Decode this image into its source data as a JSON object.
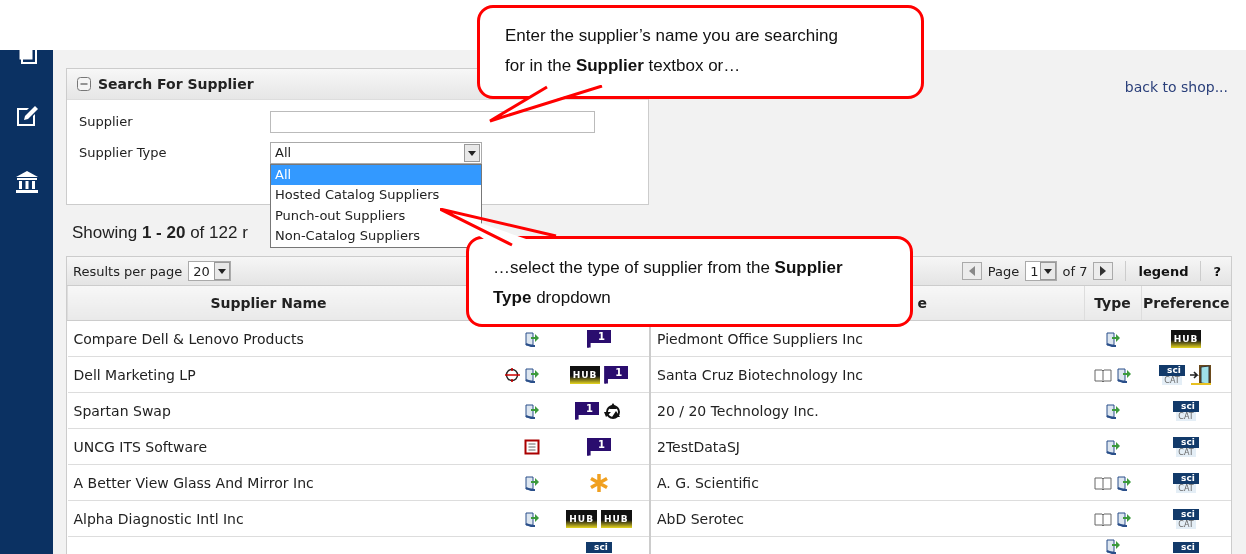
{
  "search_panel": {
    "title": "Search For Supplier",
    "fields": [
      {
        "kind": "text",
        "label": "Supplier"
      },
      {
        "kind": "select",
        "label": "Supplier Type",
        "value": "All",
        "options": [
          {
            "label": "All",
            "selected": true
          },
          {
            "label": "Hosted Catalog Suppliers",
            "selected": false
          },
          {
            "label": "Punch-out Suppliers",
            "selected": false
          },
          {
            "label": "Non-Catalog Suppliers",
            "selected": false
          }
        ]
      }
    ]
  },
  "back_link": "back to shop...",
  "summary": "Showing **1 - 20** of 122 r",
  "toolbar": {
    "results_label": "Results per page",
    "per_page": "20",
    "page_label": "Page",
    "page": "1",
    "page_total": "of 7",
    "legend": "legend",
    "help": "?"
  },
  "tables": [
    {
      "columns": [
        "Supplier Name"
      ],
      "rows": [
        {
          "name": "Compare Dell & Lenovo Products",
          "type": [
            {
              "kind": "punchout"
            }
          ],
          "preference": [
            {
              "kind": "flag",
              "text": "1"
            }
          ]
        },
        {
          "name": "Dell Marketing LP",
          "type": [
            {
              "kind": "cxml"
            },
            {
              "kind": "punchout"
            }
          ],
          "preference": [
            {
              "kind": "hub",
              "text": "HUB"
            },
            {
              "kind": "flag",
              "text": "1"
            }
          ]
        },
        {
          "name": "Spartan Swap",
          "type": [
            {
              "kind": "punchout"
            }
          ],
          "preference": [
            {
              "kind": "flag",
              "text": "1"
            },
            {
              "kind": "recycle"
            }
          ]
        },
        {
          "name": "UNCG ITS Software",
          "type": [
            {
              "kind": "form"
            }
          ],
          "preference": [
            {
              "kind": "flag",
              "text": "1"
            }
          ]
        },
        {
          "name": "A Better View Glass And Mirror Inc",
          "type": [
            {
              "kind": "punchout"
            }
          ],
          "preference": [
            {
              "kind": "asterisk"
            }
          ]
        },
        {
          "name": "Alpha Diagnostic Intl Inc",
          "type": [
            {
              "kind": "punchout"
            }
          ],
          "preference": [
            {
              "kind": "hub",
              "text": "HUB"
            },
            {
              "kind": "hub",
              "text": "HUB"
            }
          ]
        },
        {
          "type": [],
          "preference": [
            {
              "kind": "scicat",
              "text": "sci"
            }
          ]
        }
      ]
    },
    {
      "columns": [
        "e",
        "Type",
        "Preference"
      ],
      "rows": [
        {
          "name": "Piedmont Office Suppliers Inc",
          "type": [
            {
              "kind": "punchout"
            }
          ],
          "preference": [
            {
              "kind": "hub",
              "text": "HUB"
            }
          ]
        },
        {
          "name": "Santa Cruz Biotechnology Inc",
          "type": [
            {
              "kind": "catalog"
            },
            {
              "kind": "punchout"
            }
          ],
          "preference": [
            {
              "kind": "scicat",
              "text": "sci",
              "sub": "CAT"
            },
            {
              "kind": "door"
            }
          ]
        },
        {
          "name": "20 / 20 Technology Inc.",
          "type": [
            {
              "kind": "punchout"
            }
          ],
          "preference": [
            {
              "kind": "scicat",
              "text": "sci",
              "sub": "CAT"
            }
          ]
        },
        {
          "name": "2TestDataSJ",
          "type": [
            {
              "kind": "punchout"
            }
          ],
          "preference": [
            {
              "kind": "scicat",
              "text": "sci",
              "sub": "CAT"
            }
          ]
        },
        {
          "name": "A. G. Scientific",
          "type": [
            {
              "kind": "catalog"
            },
            {
              "kind": "punchout"
            }
          ],
          "preference": [
            {
              "kind": "scicat",
              "text": "sci",
              "sub": "CAT"
            }
          ]
        },
        {
          "name": "AbD Serotec",
          "type": [
            {
              "kind": "catalog"
            },
            {
              "kind": "punchout"
            }
          ],
          "preference": [
            {
              "kind": "scicat",
              "text": "sci",
              "sub": "CAT"
            }
          ]
        },
        {
          "type": [
            {
              "kind": "punchout"
            }
          ],
          "preference": [
            {
              "kind": "scicat",
              "text": "sci"
            }
          ]
        }
      ]
    }
  ],
  "callouts": [
    {
      "text": "Enter the supplier’s name you are searching for in the **Supplier** textbox or…"
    },
    {
      "text": "…select the type of supplier from the **Supplier Type** dropdown"
    }
  ]
}
